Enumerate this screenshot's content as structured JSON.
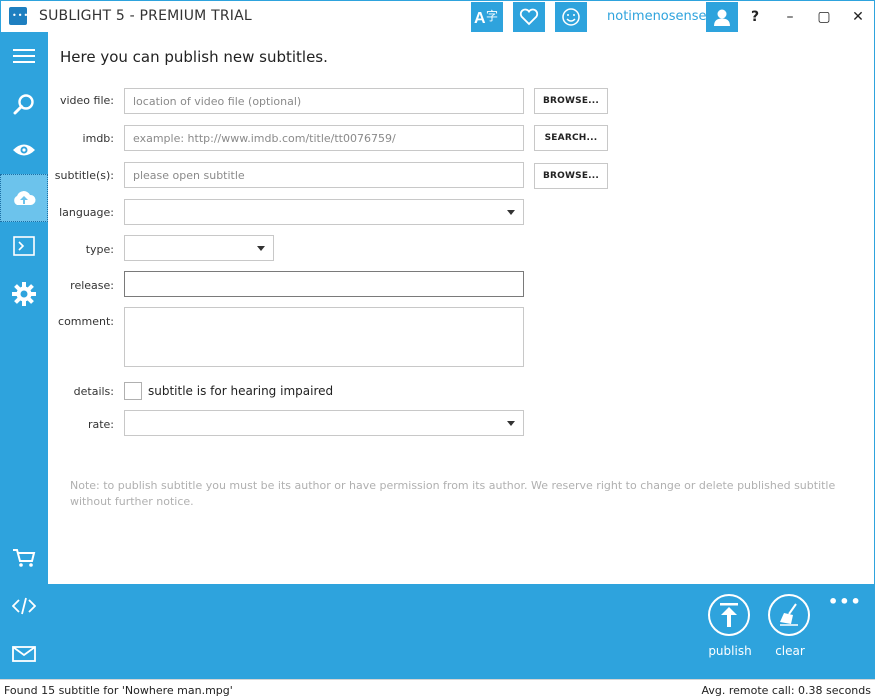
{
  "window": {
    "title": "SUBLIGHT 5 - PREMIUM TRIAL",
    "username": "notimenosense",
    "help_label": "?",
    "minimize_label": "–",
    "maximize_label": "▢",
    "close_label": "✕"
  },
  "toolbar_icons": [
    "translate-icon",
    "heart-icon",
    "smiley-icon",
    "user-icon"
  ],
  "sidebar": {
    "items": [
      {
        "name": "menu-icon"
      },
      {
        "name": "search-icon"
      },
      {
        "name": "eye-icon"
      },
      {
        "name": "cloud-upload-icon",
        "active": true
      },
      {
        "name": "terminal-icon"
      },
      {
        "name": "gear-icon"
      },
      {
        "name": "cart-icon"
      },
      {
        "name": "code-icon"
      },
      {
        "name": "mail-icon"
      }
    ]
  },
  "form": {
    "heading": "Here you can publish new subtitles.",
    "video_file": {
      "label": "video file:",
      "placeholder": "location of video file (optional)",
      "button": "BROWSE..."
    },
    "imdb": {
      "label": "imdb:",
      "placeholder": "example: http://www.imdb.com/title/tt0076759/",
      "button": "SEARCH..."
    },
    "subtitles": {
      "label": "subtitle(s):",
      "placeholder": "please open subtitle",
      "button": "BROWSE..."
    },
    "language": {
      "label": "language:",
      "value": ""
    },
    "type": {
      "label": "type:",
      "value": ""
    },
    "release": {
      "label": "release:",
      "value": ""
    },
    "comment": {
      "label": "comment:",
      "value": ""
    },
    "details": {
      "label": "details:",
      "checkbox_label": "subtitle is for hearing impaired",
      "checked": false
    },
    "rate": {
      "label": "rate:",
      "value": ""
    },
    "note": "Note: to publish subtitle you must be its author or have permission from its author. We reserve right to change or delete published subtitle without further notice."
  },
  "actions": {
    "publish_label": "publish",
    "clear_label": "clear",
    "more_label": "•••"
  },
  "status": {
    "left": "Found 15 subtitle for 'Nowhere man.mpg'",
    "right": "Avg. remote call: 0.38 seconds"
  },
  "colors": {
    "accent": "#2ea3dd",
    "sidebar_active": "#6cc3ec"
  }
}
